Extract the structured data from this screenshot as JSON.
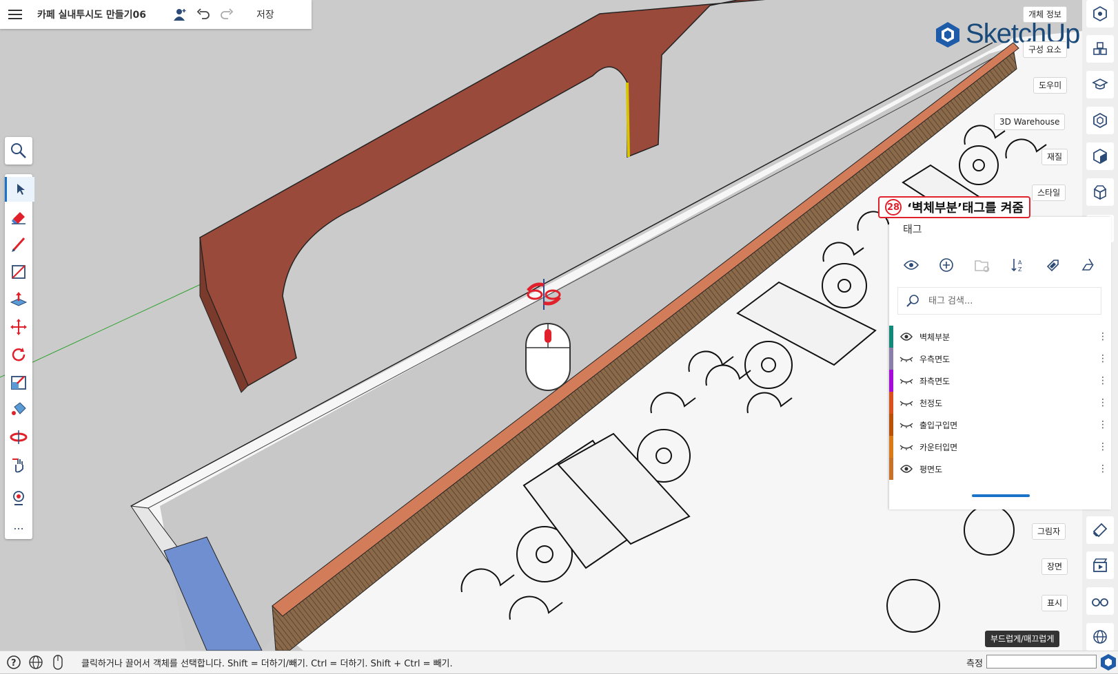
{
  "app": {
    "title": "카페 실내투시도 만들기06",
    "save_label": "저장",
    "logo_text": "SketchUp"
  },
  "left_toolbar": {
    "tools": [
      "search-icon",
      "select-icon",
      "eraser-icon",
      "pencil-icon",
      "rectangle-icon",
      "push-pull-icon",
      "move-icon",
      "rotate-icon",
      "scale-icon",
      "paint-bucket-icon",
      "orbit-icon",
      "pan-icon",
      "walk-icon",
      "more-icon"
    ],
    "more_label": "..."
  },
  "right_panels": {
    "entity_info": "개체 정보",
    "components": "구성 요소",
    "instructor": "도우미",
    "warehouse": "3D Warehouse",
    "materials": "재질",
    "styles": "스타일",
    "shadows": "그림자",
    "scenes": "장면",
    "display": "표시",
    "soften": "부드럽게/매끄럽게"
  },
  "annotation": {
    "number": "28",
    "text": "‘벽체부분’태그를 켜줌"
  },
  "tags_panel": {
    "title": "태그",
    "search_placeholder": "태그 검색...",
    "tags": [
      {
        "name": "벽체부분",
        "visible": true,
        "color": "#12887a"
      },
      {
        "name": "우측면도",
        "visible": false,
        "color": "#8a7fa8"
      },
      {
        "name": "좌측면도",
        "visible": false,
        "color": "#a40ad8"
      },
      {
        "name": "천정도",
        "visible": false,
        "color": "#d8521f"
      },
      {
        "name": "출입구입면",
        "visible": false,
        "color": "#b8520a"
      },
      {
        "name": "카운터입면",
        "visible": false,
        "color": "#d87a18"
      },
      {
        "name": "평면도",
        "visible": true,
        "color": "#c6722a"
      }
    ],
    "more_symbol": "⋮"
  },
  "statusbar": {
    "hint": "클릭하거나 끌어서 객체를 선택합니다. Shift = 더하기/빼기. Ctrl = 더하기. Shift + Ctrl = 빼기.",
    "measure_label": "측정",
    "measure_value": ""
  },
  "colors": {
    "accent": "#1a73c9",
    "annotation_red": "#e0202a",
    "wall_brown": "#9a4a3a"
  }
}
